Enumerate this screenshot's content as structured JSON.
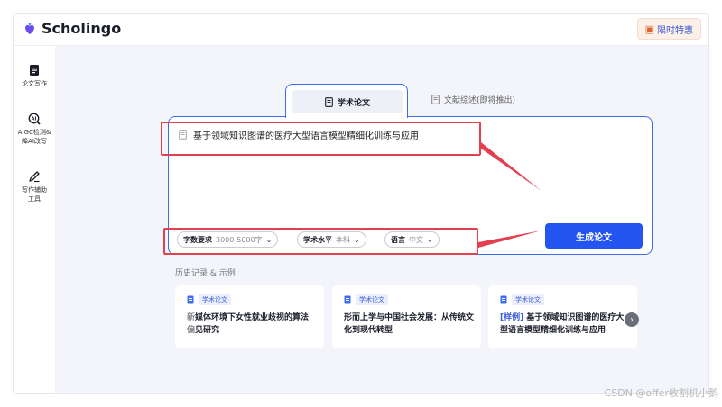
{
  "app": {
    "brand": "Scholingo",
    "promo_label": "限时特惠"
  },
  "sidebar": {
    "items": [
      {
        "label": "论文写作",
        "icon": "document-icon"
      },
      {
        "label_line1": "AIGC检测&",
        "label_line2": "降AI改写",
        "icon": "ai-search-icon"
      },
      {
        "label_line1": "写作辅助",
        "label_line2": "工具",
        "icon": "pen-icon"
      }
    ]
  },
  "tabs": [
    {
      "label": "学术论文",
      "active": true
    },
    {
      "label": "文献综述(即将推出)",
      "active": false
    }
  ],
  "editor": {
    "topic": "基于领域知识图谱的医疗大型语言模型精细化训练与应用"
  },
  "options": [
    {
      "label": "字数要求",
      "value": "3000-5000字"
    },
    {
      "label": "学术水平",
      "value": "本科"
    },
    {
      "label": "语言",
      "value": "中文"
    }
  ],
  "generate_button": "生成论文",
  "history": {
    "title": "历史记录 & 示例",
    "cards": [
      {
        "badge": "学术论文",
        "first_char": "新",
        "text": "媒体环境下女性就业歧视的算法",
        "second_first_char": "偏",
        "text2": "见研究"
      },
      {
        "badge": "学术论文",
        "text": "形而上学与中国社会发展：从传统文化到现代转型"
      },
      {
        "badge": "学术论文",
        "prefix": "[样例]",
        "text": " 基于领域知识图谱的医疗大型语言模型精细化训练与应用"
      }
    ]
  },
  "watermark": "CSDN @offer收割机小鹅",
  "colors": {
    "accent": "#2455f0",
    "highlight": "#e2404f"
  }
}
